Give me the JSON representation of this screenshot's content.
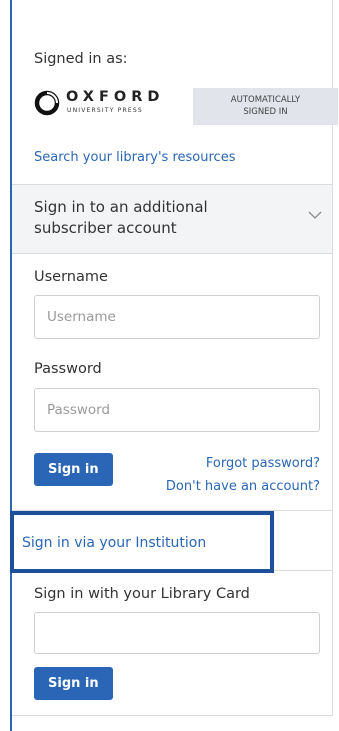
{
  "signed_in": {
    "label": "Signed in as:",
    "logo": {
      "word": "OXFORD",
      "sub": "UNIVERSITY PRESS",
      "icon": "oxford-logo-icon"
    },
    "badge_line1": "AUTOMATICALLY",
    "badge_line2": "SIGNED IN",
    "search_link": "Search your library's resources"
  },
  "accordion": {
    "title": "Sign in to an additional subscriber account",
    "icon": "chevron-down-icon"
  },
  "login": {
    "username_label": "Username",
    "username_placeholder": "Username",
    "username_value": "",
    "password_label": "Password",
    "password_placeholder": "Password",
    "password_value": "",
    "signin_button": "Sign in",
    "forgot_link": "Forgot password?",
    "no_account_link": "Don't have an account?"
  },
  "institution": {
    "link": "Sign in via your Institution"
  },
  "library_card": {
    "label": "Sign in with your Library Card",
    "value": "",
    "signin_button": "Sign in"
  },
  "colors": {
    "accent": "#2a66b5",
    "highlight_box": "#1e4f9b",
    "badge_bg": "#e1e4ea",
    "accordion_bg": "#f3f4f6"
  }
}
